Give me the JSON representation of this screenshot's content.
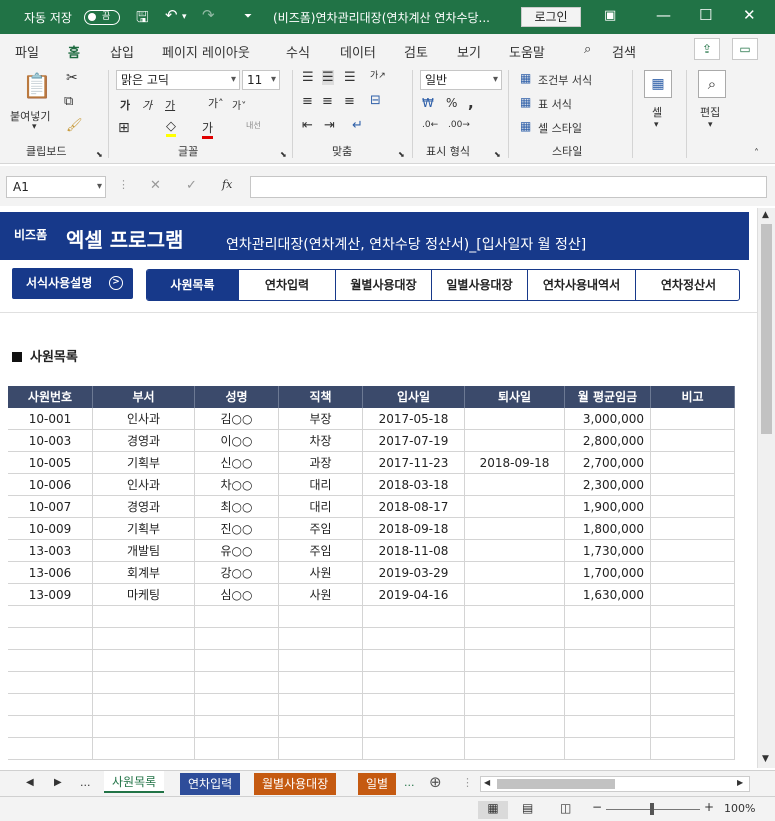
{
  "titlebar": {
    "autosave_label": "자동 저장",
    "autosave_state": "끔",
    "doc_title": "(비즈폼)연차관리대장(연차계산 연차수당...",
    "login_label": "로그인"
  },
  "menu": {
    "items": [
      "파일",
      "홈",
      "삽입",
      "페이지 레이아웃",
      "수식",
      "데이터",
      "검토",
      "보기",
      "도움말"
    ],
    "active": "홈",
    "search_label": "검색"
  },
  "ribbon": {
    "groups": [
      "클립보드",
      "글꼴",
      "맞춤",
      "표시 형식",
      "스타일"
    ],
    "paste_label": "붙여넣기",
    "font_name": "맑은 고딕",
    "font_size": "11",
    "number_format": "일반",
    "style_items": [
      "조건부 서식",
      "표 서식",
      "셀 스타일"
    ],
    "cell_label": "셀",
    "edit_label": "편집",
    "wrap_label": "내선"
  },
  "formula": {
    "name_box": "A1",
    "fx_label": "fx"
  },
  "sheet": {
    "logo_mark": "비즈폼",
    "logo_title": "엑셀 프로그램",
    "banner_subtitle": "연차관리대장(연차계산, 연차수당 정산서)_[입사일자 월 정산]",
    "guide_button": "서식사용설명",
    "nav_tabs": [
      "사원목록",
      "연차입력",
      "월별사용대장",
      "일별사용대장",
      "연차사용내역서",
      "연차정산서"
    ],
    "nav_active": "사원목록",
    "section_title": "사원목록",
    "table": {
      "headers": [
        "사원번호",
        "부서",
        "성명",
        "직책",
        "입사일",
        "퇴사일",
        "월 평균임금",
        "비고"
      ],
      "rows": [
        [
          "10-001",
          "인사과",
          "김○○",
          "부장",
          "2017-05-18",
          "",
          "3,000,000",
          ""
        ],
        [
          "10-003",
          "경영과",
          "이○○",
          "차장",
          "2017-07-19",
          "",
          "2,800,000",
          ""
        ],
        [
          "10-005",
          "기획부",
          "신○○",
          "과장",
          "2017-11-23",
          "2018-09-18",
          "2,700,000",
          ""
        ],
        [
          "10-006",
          "인사과",
          "차○○",
          "대리",
          "2018-03-18",
          "",
          "2,300,000",
          ""
        ],
        [
          "10-007",
          "경영과",
          "최○○",
          "대리",
          "2018-08-17",
          "",
          "1,900,000",
          ""
        ],
        [
          "10-009",
          "기획부",
          "진○○",
          "주임",
          "2018-09-18",
          "",
          "1,800,000",
          ""
        ],
        [
          "13-003",
          "개발팀",
          "유○○",
          "주임",
          "2018-11-08",
          "",
          "1,730,000",
          ""
        ],
        [
          "13-006",
          "회계부",
          "강○○",
          "사원",
          "2019-03-29",
          "",
          "1,700,000",
          ""
        ],
        [
          "13-009",
          "마케팅",
          "심○○",
          "사원",
          "2019-04-16",
          "",
          "1,630,000",
          ""
        ]
      ],
      "empty_rows": 7
    }
  },
  "sheet_tabs": {
    "items": [
      {
        "label": "사원목록",
        "color": "#ffffff",
        "text": "#217346"
      },
      {
        "label": "연차입력",
        "color": "#2e4d9a",
        "text": "#ffffff"
      },
      {
        "label": "월별사용대장",
        "color": "#c55a11",
        "text": "#ffffff"
      },
      {
        "label": "일별",
        "color": "#c55a11",
        "text": "#ffffff"
      }
    ],
    "more": "..."
  },
  "status": {
    "zoom": "100%"
  },
  "colors": {
    "excel_green": "#217346",
    "banner_blue": "#17398a",
    "table_header": "#3b4a6b"
  }
}
